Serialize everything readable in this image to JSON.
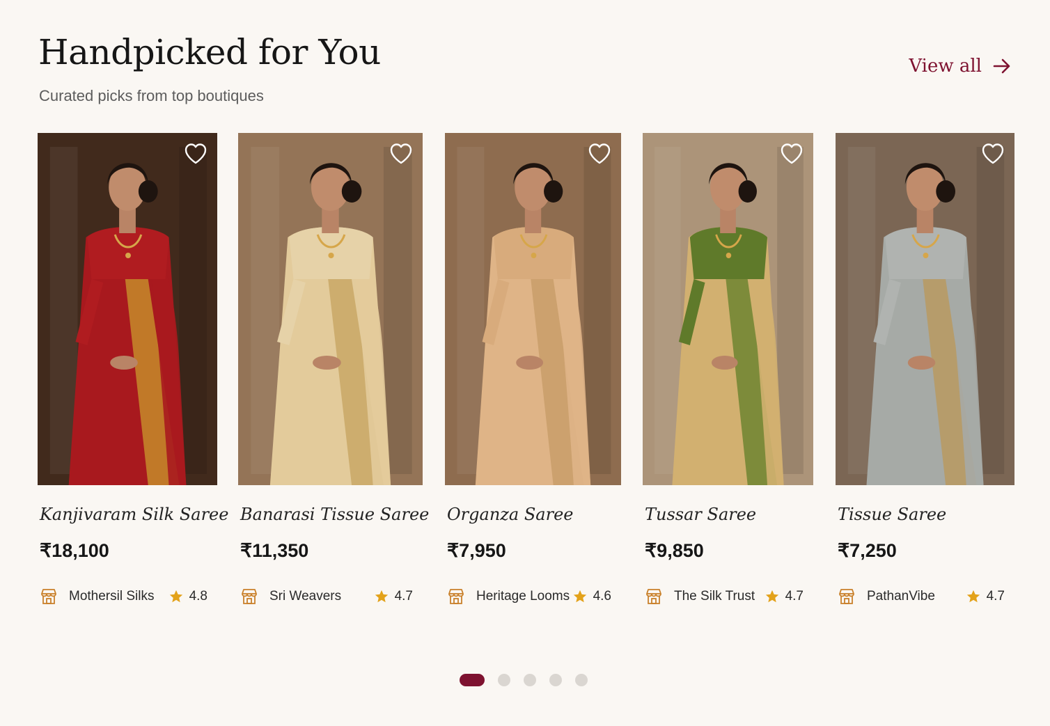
{
  "header": {
    "title": "Handpicked for You",
    "subtitle": "Curated picks from top boutiques",
    "view_all_label": "View all",
    "view_all_icon": "arrow-right-icon"
  },
  "colors": {
    "accent": "#7e1230",
    "background": "#faf7f3",
    "star": "#e3a21a",
    "dot_inactive": "#dad6d1"
  },
  "products": [
    {
      "name": "Kanjivaram Silk Saree",
      "price": "₹18,100",
      "store": "Mothersil Silks",
      "rating": "4.8",
      "saree_color": "#a8191e",
      "border_color": "#c68b2a",
      "blouse_color": "#b01c20",
      "backdrop_color": "#4a3020"
    },
    {
      "name": "Banarasi Tissue Saree",
      "price": "₹11,350",
      "store": "Sri Weavers",
      "rating": "4.7",
      "saree_color": "#e3cb9b",
      "border_color": "#c9a866",
      "blouse_color": "#e6d2a8",
      "backdrop_color": "#a98463"
    },
    {
      "name": "Organza Saree",
      "price": "₹7,950",
      "store": "Heritage Looms",
      "rating": "4.6",
      "saree_color": "#dfb487",
      "border_color": "#c99d6a",
      "blouse_color": "#d8ab7c",
      "backdrop_color": "#a27c5a"
    },
    {
      "name": "Tussar Saree",
      "price": "₹9,850",
      "store": "The Silk Trust",
      "rating": "4.7",
      "saree_color": "#d2b070",
      "border_color": "#6f8530",
      "blouse_color": "#5f7a2a",
      "backdrop_color": "#c4a98a"
    },
    {
      "name": "Tissue Saree",
      "price": "₹7,250",
      "store": "PathanVibe",
      "rating": "4.7",
      "saree_color": "#a6aaa6",
      "border_color": "#b89a60",
      "blouse_color": "#b0b3b0",
      "backdrop_color": "#8c7560"
    }
  ],
  "carousel": {
    "page_count": 5,
    "active_page": 1
  }
}
